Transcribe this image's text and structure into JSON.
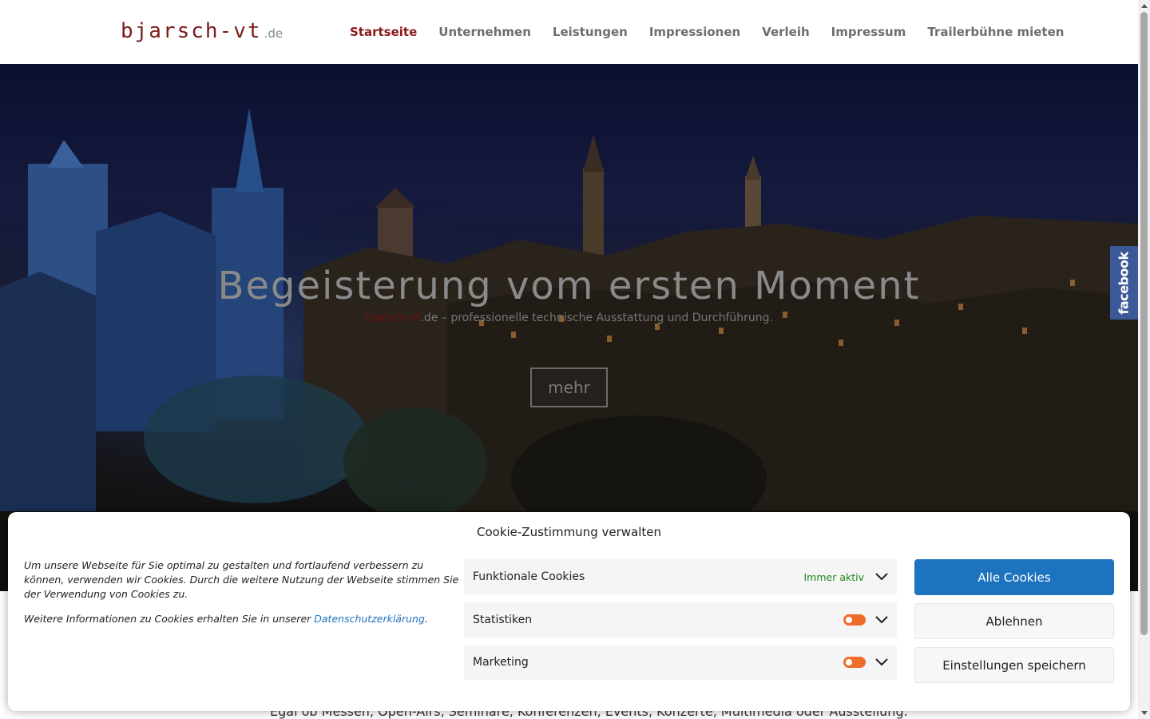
{
  "header": {
    "logo_main": "bjarsch-vt",
    "logo_tld": ".de",
    "nav": [
      {
        "label": "Startseite",
        "active": true
      },
      {
        "label": "Unternehmen"
      },
      {
        "label": "Leistungen"
      },
      {
        "label": "Impressionen"
      },
      {
        "label": "Verleih"
      },
      {
        "label": "Impressum"
      },
      {
        "label": "Trailerbühne mieten"
      }
    ]
  },
  "hero": {
    "title": "Begeisterung vom ersten Moment",
    "sub_brand": "bjarsch-vt",
    "sub_rest": ".de – professionelle technische Ausstattung und Durchführung.",
    "button_label": "mehr"
  },
  "facebook_tab": {
    "label": "facebook",
    "color": "#3b5998"
  },
  "page_text_below": "Egal ob Messen, Open-Airs, Seminare, Konferenzen, Events, Konzerte, Multimedia oder Ausstellung.",
  "cookie": {
    "title": "Cookie-Zustimmung verwalten",
    "message": "Um unsere Webseite für Sie optimal zu gestalten und fortlaufend verbessern zu können, verwenden wir Cookies. Durch die weitere Nutzung der Webseite stimmen Sie der Verwendung von Cookies zu.",
    "more_text": "Weitere Informationen zu Cookies erhalten Sie in unserer ",
    "privacy_link": "Datenschutzerklärung",
    "more_suffix": ".",
    "categories": [
      {
        "name": "Funktionale Cookies",
        "status": "Immer aktiv"
      },
      {
        "name": "Statistiken"
      },
      {
        "name": "Marketing"
      }
    ],
    "buttons": {
      "accept_all": "Alle Cookies",
      "deny": "Ablehnen",
      "save": "Einstellungen speichern"
    },
    "accent_color": "#1e73be",
    "toggle_color": "#ef6c2b"
  }
}
